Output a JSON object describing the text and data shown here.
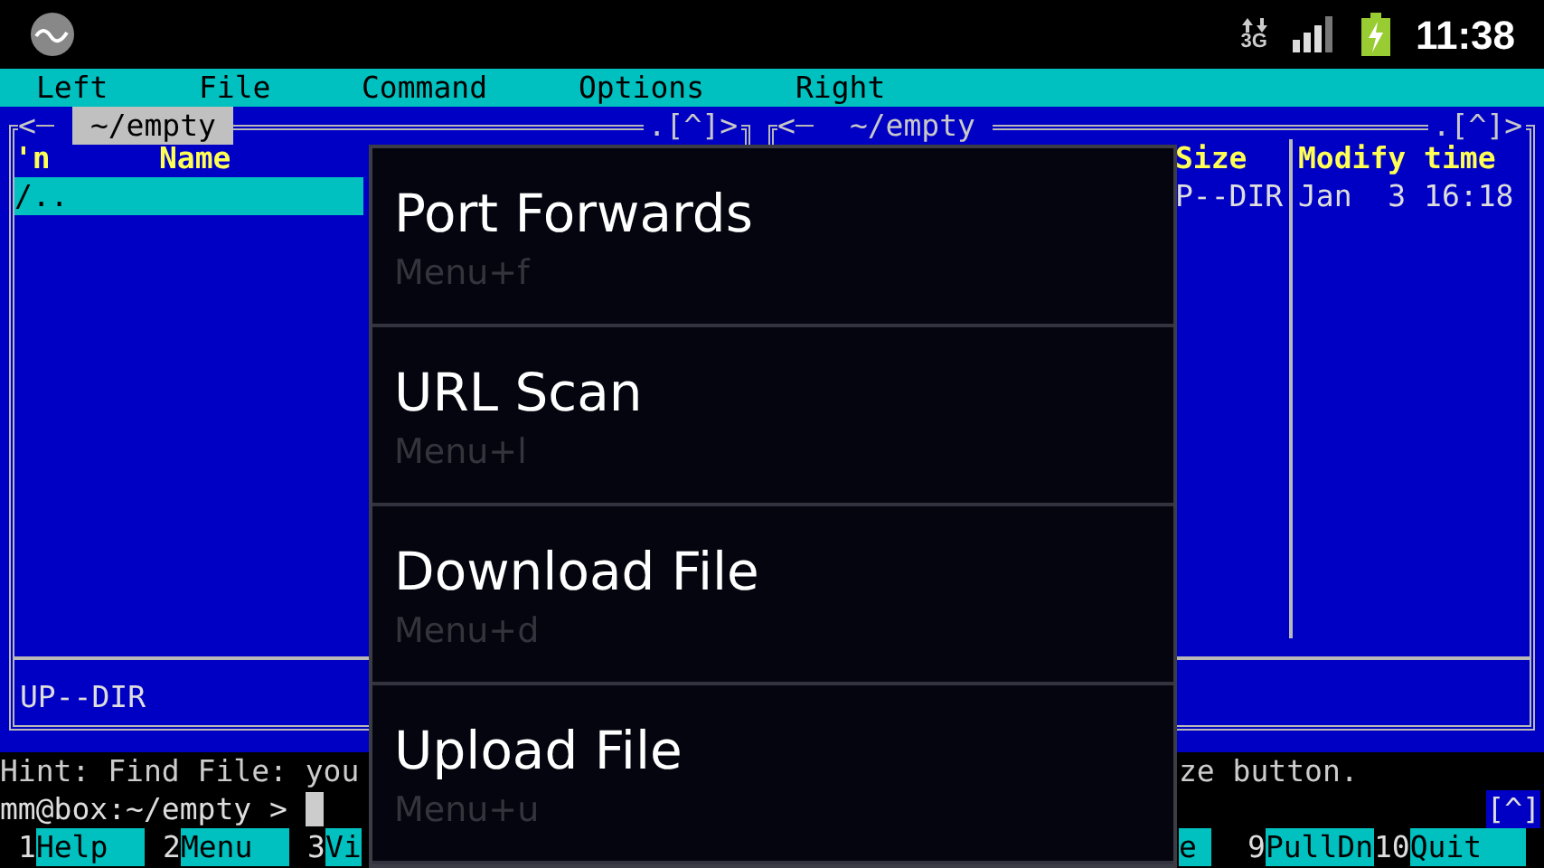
{
  "status_bar": {
    "network_label": "3G",
    "time": "11:38"
  },
  "menubar": [
    "Left",
    "File",
    "Command",
    "Options",
    "Right"
  ],
  "panels": [
    {
      "active": true,
      "back": "<",
      "title": "~/empty",
      "corner": ".[^]>",
      "headers": [
        "'n",
        "Name"
      ],
      "rows": [
        {
          "cells": [
            "/.."
          ],
          "selected": true
        }
      ],
      "status": "UP--DIR"
    },
    {
      "active": false,
      "back": "<",
      "title": "~/empty",
      "corner": ".[^]>",
      "headers": [
        "Size",
        "Modify time"
      ],
      "rows": [
        {
          "cells": [
            "P--DIR",
            "Jan  3 16:18"
          ],
          "selected": false
        }
      ]
    }
  ],
  "hint": {
    "left": "Hint: Find File: you",
    "right": "ze button."
  },
  "prompt": {
    "text": "mm@box:~/empty >",
    "cursor": true,
    "scroll_mark": "[^]"
  },
  "function_keys_left": [
    {
      "number": "1",
      "label": "Help"
    },
    {
      "number": "2",
      "label": "Menu"
    },
    {
      "number": "3",
      "label": "Vi"
    }
  ],
  "function_keys_right": [
    {
      "label": "e"
    },
    {
      "number": "9",
      "label": "PullDn"
    },
    {
      "number": "10",
      "label": "Quit"
    }
  ],
  "menu": [
    {
      "title": "Port Forwards",
      "shortcut": "Menu+f"
    },
    {
      "title": "URL Scan",
      "shortcut": "Menu+l"
    },
    {
      "title": "Download File",
      "shortcut": "Menu+d"
    },
    {
      "title": "Upload File",
      "shortcut": "Menu+u"
    }
  ]
}
